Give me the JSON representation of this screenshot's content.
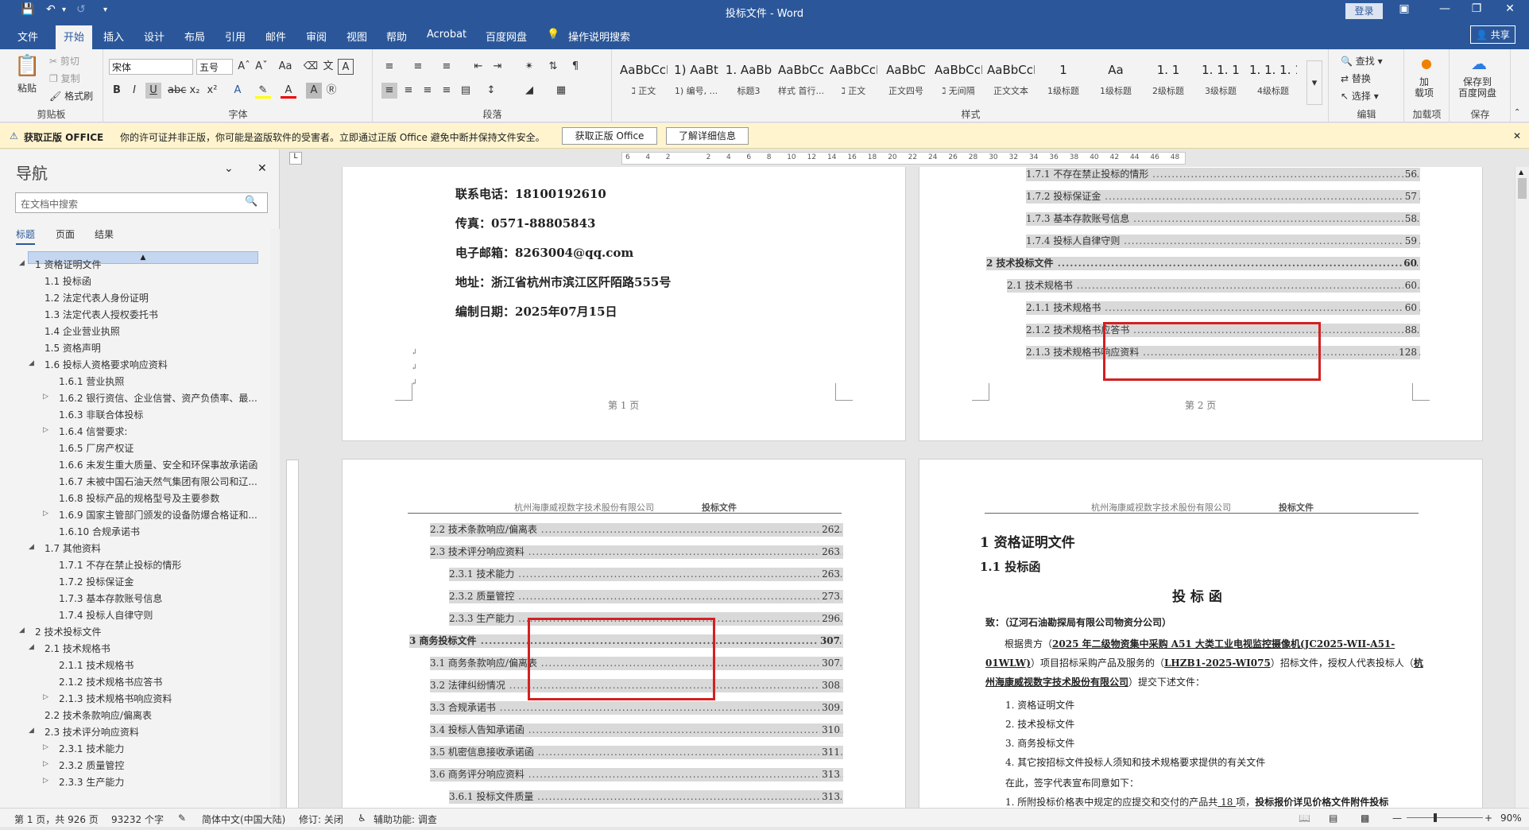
{
  "title_bar": {
    "title": "投标文件 - Word",
    "login": "登录",
    "share": "共享"
  },
  "tabs": [
    "文件",
    "开始",
    "插入",
    "设计",
    "布局",
    "引用",
    "邮件",
    "审阅",
    "视图",
    "帮助",
    "Acrobat",
    "百度网盘",
    "操作说明搜索"
  ],
  "ribbon": {
    "clipboard": {
      "paste": "粘贴",
      "cut": "剪切",
      "copy": "复制",
      "format_painter": "格式刷",
      "label": "剪贴板"
    },
    "font": {
      "name": "宋体",
      "size": "五号",
      "label": "字体"
    },
    "paragraph": {
      "label": "段落"
    },
    "styles": {
      "label": "样式",
      "items": [
        {
          "sample": "AaBbCcI",
          "name": "ℷ 正文"
        },
        {
          "sample": "1) AaBt",
          "name": "1) 编号, ..."
        },
        {
          "sample": "1. AaBb",
          "name": "标题3"
        },
        {
          "sample": "AaBbCc",
          "name": "样式 首行..."
        },
        {
          "sample": "AaBbCcDdI",
          "name": "ℷ 正文"
        },
        {
          "sample": "AaBbC",
          "name": "正文四号"
        },
        {
          "sample": "AaBbCcD",
          "name": "ℷ 无间隔"
        },
        {
          "sample": "AaBbCcD",
          "name": "正文文本"
        },
        {
          "sample": "1",
          "name": "1级标题"
        },
        {
          "sample": "Aa",
          "name": "1级标题"
        },
        {
          "sample": "1. 1",
          "name": "2级标题"
        },
        {
          "sample": "1. 1. 1",
          "name": "3级标题"
        },
        {
          "sample": "1. 1. 1. 1",
          "name": "4级标题"
        }
      ]
    },
    "editing": {
      "find": "查找",
      "replace": "替换",
      "select": "选择",
      "label": "编辑"
    },
    "addins": {
      "load": "加\n载项",
      "label": "加载项"
    },
    "save": {
      "save_to": "保存到\n百度网盘",
      "label": "保存"
    }
  },
  "infobar": {
    "title": "获取正版 OFFICE",
    "message": "你的许可证并非正版，你可能是盗版软件的受害者。立即通过正版 Office 避免中断并保持文件安全。",
    "btn1": "获取正版 Office",
    "btn2": "了解详细信息"
  },
  "navigation": {
    "title": "导航",
    "search_placeholder": "在文档中搜索",
    "tabs": [
      "标题",
      "页面",
      "结果"
    ],
    "items": [
      {
        "text": "1 资格证明文件",
        "level": 1,
        "expander": "open"
      },
      {
        "text": "1.1 投标函",
        "level": 2,
        "expander": ""
      },
      {
        "text": "1.2 法定代表人身份证明",
        "level": 2,
        "expander": ""
      },
      {
        "text": "1.3 法定代表人授权委托书",
        "level": 2,
        "expander": ""
      },
      {
        "text": "1.4 企业营业执照",
        "level": 2,
        "expander": ""
      },
      {
        "text": "1.5 资格声明",
        "level": 2,
        "expander": ""
      },
      {
        "text": "1.6 投标人资格要求响应资料",
        "level": 2,
        "expander": "open"
      },
      {
        "text": "1.6.1 营业执照",
        "level": 3,
        "expander": ""
      },
      {
        "text": "1.6.2 银行资信、企业信誉、资产负债率、最...",
        "level": 3,
        "expander": "closed"
      },
      {
        "text": "1.6.3 非联合体投标",
        "level": 3,
        "expander": ""
      },
      {
        "text": "1.6.4 信誉要求:",
        "level": 3,
        "expander": "closed"
      },
      {
        "text": "1.6.5 厂房产权证",
        "level": 3,
        "expander": ""
      },
      {
        "text": "1.6.6 未发生重大质量、安全和环保事故承诺函",
        "level": 3,
        "expander": ""
      },
      {
        "text": "1.6.7 未被中国石油天然气集团有限公司和辽...",
        "level": 3,
        "expander": ""
      },
      {
        "text": "1.6.8 投标产品的规格型号及主要参数",
        "level": 3,
        "expander": ""
      },
      {
        "text": "1.6.9 国家主管部门颁发的设备防爆合格证和...",
        "level": 3,
        "expander": "closed"
      },
      {
        "text": "1.6.10 合规承诺书",
        "level": 3,
        "expander": ""
      },
      {
        "text": "1.7 其他资料",
        "level": 2,
        "expander": "open"
      },
      {
        "text": "1.7.1 不存在禁止投标的情形",
        "level": 3,
        "expander": ""
      },
      {
        "text": "1.7.2 投标保证金",
        "level": 3,
        "expander": ""
      },
      {
        "text": "1.7.3 基本存款账号信息",
        "level": 3,
        "expander": ""
      },
      {
        "text": "1.7.4 投标人自律守则",
        "level": 3,
        "expander": ""
      },
      {
        "text": "2 技术投标文件",
        "level": 1,
        "expander": "open"
      },
      {
        "text": "2.1 技术规格书",
        "level": 2,
        "expander": "open"
      },
      {
        "text": "2.1.1 技术规格书",
        "level": 3,
        "expander": ""
      },
      {
        "text": "2.1.2 技术规格书应答书",
        "level": 3,
        "expander": ""
      },
      {
        "text": "2.1.3 技术规格书响应资料",
        "level": 3,
        "expander": "closed"
      },
      {
        "text": "2.2 技术条款响应/偏离表",
        "level": 2,
        "expander": ""
      },
      {
        "text": "2.3 技术评分响应资料",
        "level": 2,
        "expander": "open"
      },
      {
        "text": "2.3.1 技术能力",
        "level": 3,
        "expander": "closed"
      },
      {
        "text": "2.3.2 质量管控",
        "level": 3,
        "expander": "closed"
      },
      {
        "text": "2.3.3 生产能力",
        "level": 3,
        "expander": "closed"
      }
    ]
  },
  "ruler": {
    "ticks": [
      "6",
      "4",
      "2",
      "",
      "2",
      "4",
      "6",
      "8",
      "10",
      "12",
      "14",
      "16",
      "18",
      "20",
      "22",
      "24",
      "26",
      "28",
      "30",
      "32",
      "34",
      "36",
      "38",
      "40",
      "42",
      "44",
      "46",
      "48"
    ]
  },
  "pages": {
    "page1": {
      "lines": [
        {
          "label": "联系电话：",
          "value": "18100192610"
        },
        {
          "label": "传真：",
          "value": "0571-88805843"
        },
        {
          "label": "电子邮箱：",
          "value": "8263004@qq.com"
        },
        {
          "label": "地址：",
          "value": "浙江省杭州市滨江区阡陌路555号"
        },
        {
          "label": "编制日期：",
          "value": "2025年07月15日"
        }
      ],
      "footer": "第 1 页"
    },
    "page2": {
      "toc": [
        {
          "text": "1.7.1 不存在禁止投标的情形",
          "page": "56",
          "level": 3
        },
        {
          "text": "1.7.2 投标保证金",
          "page": "57",
          "level": 3
        },
        {
          "text": "1.7.3 基本存款账号信息",
          "page": "58",
          "level": 3
        },
        {
          "text": "1.7.4 投标人自律守则",
          "page": "59",
          "level": 3
        },
        {
          "text": "2  技术投标文件",
          "page": "60",
          "level": 1
        },
        {
          "text": "2.1  技术规格书",
          "page": "60",
          "level": 2
        },
        {
          "text": "2.1.1 技术规格书",
          "page": "60",
          "level": 3
        },
        {
          "text": "2.1.2 技术规格书应答书",
          "page": "88",
          "level": 3
        },
        {
          "text": "2.1.3 技术规格书响应资料",
          "page": "128",
          "level": 3
        }
      ],
      "footer": "第 2 页"
    },
    "page3": {
      "header_company": "杭州海康威视数字技术股份有限公司",
      "header_doc": "投标文件",
      "toc": [
        {
          "text": "2.2  技术条款响应/偏离表",
          "page": "262",
          "level": 2
        },
        {
          "text": "2.3  技术评分响应资料",
          "page": "263",
          "level": 2
        },
        {
          "text": "2.3.1 技术能力",
          "page": "263",
          "level": 3
        },
        {
          "text": "2.3.2 质量管控",
          "page": "273",
          "level": 3
        },
        {
          "text": "2.3.3 生产能力",
          "page": "296",
          "level": 3
        },
        {
          "text": "3  商务投标文件",
          "page": "307",
          "level": 1
        },
        {
          "text": "3.1  商务条款响应/偏离表",
          "page": "307",
          "level": 2
        },
        {
          "text": "3.2  法律纠纷情况",
          "page": "308",
          "level": 2
        },
        {
          "text": "3.3  合规承诺书",
          "page": "309",
          "level": 2
        },
        {
          "text": "3.4  投标人告知承诺函",
          "page": "310",
          "level": 2
        },
        {
          "text": "3.5  机密信息接收承诺函",
          "page": "311",
          "level": 2
        },
        {
          "text": "3.6  商务评分响应资料",
          "page": "313",
          "level": 2
        },
        {
          "text": "3.6.1 投标文件质量",
          "page": "313",
          "level": 3
        }
      ]
    },
    "page4": {
      "header_company": "杭州海康威视数字技术股份有限公司",
      "header_doc": "投标文件",
      "h1": "1  资格证明文件",
      "h2": "1.1  投标函",
      "h3": "投 标 函",
      "to": "致：（辽河石油勘探局有限公司物资分公司）",
      "para_a": "根据贵方（",
      "para_b": "2025 年二级物资集中采购 A51 大类工业电视监控摄像机(JC2025-WII-A51-",
      "para_c": "01WLW)",
      "para_d": "）项目招标采购产品及服务的（",
      "para_e": "LHZB1-2025-WI075",
      "para_f": "）招标文件，授权人代表投标人（",
      "para_g": "杭州海",
      "para_h": "康威视数字技术股份有限公司",
      "para_i": "）提交下述文件：",
      "list": [
        "1.   资格证明文件",
        "2.   技术投标文件",
        "3.   商务投标文件",
        "4.   其它按招标文件投标人须知和技术规格要求提供的有关文件"
      ],
      "declare": "在此，签字代表宣布同意如下：",
      "item1a": "1.  所附投标价格表中规定的应提交和交付的产品共",
      "item1b": " 18 ",
      "item1c": "项，",
      "item1d": "投标报价详见价格文件附件投标"
    }
  },
  "status": {
    "page": "第 1 页，共 926 页",
    "words": "93232 个字",
    "lang": "简体中文(中国大陆)",
    "track": "修订: 关闭",
    "access": "辅助功能: 调查",
    "zoom": "90%"
  }
}
